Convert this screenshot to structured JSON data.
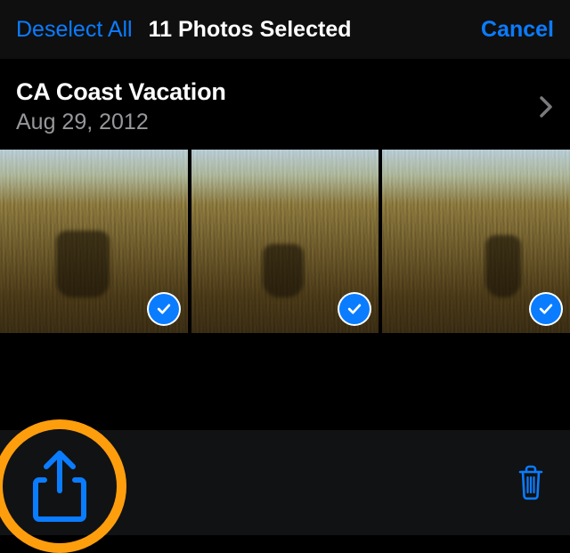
{
  "header": {
    "deselect_label": "Deselect All",
    "title": "11 Photos Selected",
    "cancel_label": "Cancel"
  },
  "album": {
    "title": "CA Coast Vacation",
    "date": "Aug 29, 2012"
  },
  "thumbnails": [
    {
      "selected": true
    },
    {
      "selected": true
    },
    {
      "selected": true
    }
  ],
  "icons": {
    "share": "share-icon",
    "trash": "trash-icon",
    "chevron": "chevron-right-icon",
    "check": "checkmark-icon"
  },
  "annotation": {
    "highlight": "share-button"
  }
}
